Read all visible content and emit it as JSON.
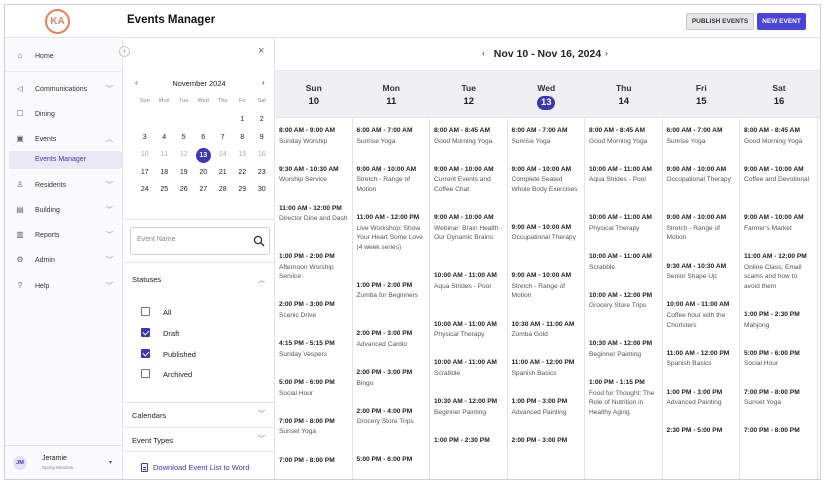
{
  "app": {
    "logo_text": "KA",
    "title": "Events Manager",
    "publish_label": "PUBLISH EVENTS",
    "new_event_label": "NEW EVENT"
  },
  "sidebar": {
    "items": [
      {
        "key": "home",
        "label": "Home",
        "icon": "home-icon",
        "chevron": false
      },
      {
        "key": "communications",
        "label": "Communications",
        "icon": "megaphone-icon",
        "chevron": true
      },
      {
        "key": "dining",
        "label": "Dining",
        "icon": "dining-icon",
        "chevron": false
      },
      {
        "key": "events",
        "label": "Events",
        "icon": "calendar-icon",
        "chevron": true,
        "expanded": true
      },
      {
        "key": "residents",
        "label": "Residents",
        "icon": "person-icon",
        "chevron": true
      },
      {
        "key": "building",
        "label": "Building",
        "icon": "building-icon",
        "chevron": true
      },
      {
        "key": "reports",
        "label": "Reports",
        "icon": "bar-chart-icon",
        "chevron": true
      },
      {
        "key": "admin",
        "label": "Admin",
        "icon": "gear-icon",
        "chevron": true
      },
      {
        "key": "help",
        "label": "Help",
        "icon": "help-icon",
        "chevron": true
      }
    ],
    "active_sub": "Events Manager"
  },
  "user": {
    "initials": "JM",
    "name": "Jeramie",
    "location": "Spring Meadow"
  },
  "mini_calendar": {
    "month_label": "November 2024",
    "weekdays": [
      "Sun",
      "Mon",
      "Tue",
      "Wed",
      "Thu",
      "Fri",
      "Sat"
    ],
    "weeks": [
      [
        "",
        "",
        "",
        "",
        "",
        "1",
        "2"
      ],
      [
        "3",
        "4",
        "5",
        "6",
        "7",
        "8",
        "9"
      ],
      [
        "10",
        "11",
        "12",
        "13",
        "14",
        "15",
        "16"
      ],
      [
        "17",
        "18",
        "19",
        "20",
        "21",
        "22",
        "23"
      ],
      [
        "24",
        "25",
        "26",
        "27",
        "28",
        "29",
        "30"
      ]
    ],
    "today": "13",
    "muted_days": [
      "10",
      "11",
      "12",
      "14",
      "15",
      "16"
    ]
  },
  "filters": {
    "search_placeholder": "Event Name",
    "statuses_label": "Statuses",
    "statuses": [
      {
        "label": "All",
        "checked": false
      },
      {
        "label": "Draft",
        "checked": true
      },
      {
        "label": "Published",
        "checked": true
      },
      {
        "label": "Archived",
        "checked": false
      }
    ],
    "calendars_label": "Calendars",
    "event_types_label": "Event Types",
    "download_label": "Download Event List to Word"
  },
  "week": {
    "range_label": "Nov 10 - Nov 16, 2024",
    "current_day": "13",
    "days": [
      {
        "name": "Sun",
        "num": "10",
        "events": [
          {
            "time": "8:00 AM - 9:00 AM",
            "title": "Sunday Worship"
          },
          {
            "time": "9:30 AM - 10:30 AM",
            "title": "Worship Service"
          },
          {
            "time": "11:00 AM - 12:00 PM",
            "title": "Director Dine and Dash"
          },
          {
            "time": "1:00 PM - 2:00 PM",
            "title": "Afternoon Worship Service"
          },
          {
            "time": "2:00 PM - 3:00 PM",
            "title": "Scenic Drive"
          },
          {
            "time": "4:15 PM - 5:15 PM",
            "title": "Sunday Vespers"
          },
          {
            "time": "5:00 PM - 6:00 PM",
            "title": "Social Hour"
          },
          {
            "time": "7:00 PM - 8:00 PM",
            "title": "Sunset Yoga"
          },
          {
            "time": "7:00 PM - 8:00 PM",
            "title": ""
          }
        ]
      },
      {
        "name": "Mon",
        "num": "11",
        "events": [
          {
            "time": "6:00 AM - 7:00 AM",
            "title": "Sunrise Yoga"
          },
          {
            "time": "9:00 AM - 10:00 AM",
            "title": "Stretch - Range of Motion"
          },
          {
            "time": "11:00 AM - 12:00 PM",
            "title": "Live Workshop: Show Your Heart Some Love (4 week series)"
          },
          {
            "time": "1:00 PM - 2:00 PM",
            "title": "Zumba for Beginners"
          },
          {
            "time": "2:00 PM - 3:00 PM",
            "title": "Advanced Cardio"
          },
          {
            "time": "2:00 PM - 3:00 PM",
            "title": "Bingo"
          },
          {
            "time": "2:00 PM - 4:00 PM",
            "title": "Grocery Store Trips"
          },
          {
            "time": "5:00 PM - 6:00 PM",
            "title": ""
          }
        ]
      },
      {
        "name": "Tue",
        "num": "12",
        "events": [
          {
            "time": "8:00 AM - 8:45 AM",
            "title": "Good Morning Yoga"
          },
          {
            "time": "9:00 AM - 10:00 AM",
            "title": "Current Events and Coffee Chat"
          },
          {
            "time": "9:00 AM - 10:00 AM",
            "title": "Webinar: Brain Health - Our Dynamic Brains"
          },
          {
            "time": "10:00 AM - 11:00 AM",
            "title": "Aqua Strides - Pool"
          },
          {
            "time": "10:00 AM - 11:00 AM",
            "title": "Physical Therapy"
          },
          {
            "time": "10:00 AM - 11:00 AM",
            "title": "Scrabble"
          },
          {
            "time": "10:30 AM - 12:00 PM",
            "title": "Beginner Painting"
          },
          {
            "time": "1:00 PM - 2:30 PM",
            "title": ""
          }
        ]
      },
      {
        "name": "Wed",
        "num": "13",
        "events": [
          {
            "time": "6:00 AM - 7:00 AM",
            "title": "Sunrise Yoga"
          },
          {
            "time": "9:00 AM - 10:00 AM",
            "title": "Complete Seated Whole Body Exercises"
          },
          {
            "time": "9:00 AM - 10:00 AM",
            "title": "Occupational Therapy"
          },
          {
            "time": "9:00 AM - 10:00 AM",
            "title": "Stretch - Range of Motion"
          },
          {
            "time": "10:30 AM - 11:00 AM",
            "title": "Zumba Gold"
          },
          {
            "time": "11:00 AM - 12:00 PM",
            "title": "Spanish Basics"
          },
          {
            "time": "1:00 PM - 3:00 PM",
            "title": "Advanced Painting"
          },
          {
            "time": "2:00 PM - 3:00 PM",
            "title": ""
          }
        ]
      },
      {
        "name": "Thu",
        "num": "14",
        "events": [
          {
            "time": "8:00 AM - 8:45 AM",
            "title": "Good Morning Yoga"
          },
          {
            "time": "10:00 AM - 11:00 AM",
            "title": "Aqua Strides - Pool"
          },
          {
            "time": "10:00 AM - 11:00 AM",
            "title": "Physical Therapy"
          },
          {
            "time": "10:00 AM - 11:00 AM",
            "title": "Scrabble"
          },
          {
            "time": "10:00 AM - 12:00 PM",
            "title": "Grocery Store Trips"
          },
          {
            "time": "10:30 AM - 12:00 PM",
            "title": "Beginner Painting"
          },
          {
            "time": "1:00 PM - 1:15 PM",
            "title": "Food for Thought: The Role of Nutrition in Healthy Aging"
          }
        ]
      },
      {
        "name": "Fri",
        "num": "15",
        "events": [
          {
            "time": "6:00 AM - 7:00 AM",
            "title": "Sunrise Yoga"
          },
          {
            "time": "9:00 AM - 10:00 AM",
            "title": "Occupational Therapy"
          },
          {
            "time": "9:00 AM - 10:00 AM",
            "title": "Stretch - Range of Motion"
          },
          {
            "time": "9:30 AM - 10:30 AM",
            "title": "Senior Shape Up"
          },
          {
            "time": "10:00 AM - 11:00 AM",
            "title": "Coffee hour with the Choristers"
          },
          {
            "time": "11:00 AM - 12:00 PM",
            "title": "Spanish Basics"
          },
          {
            "time": "1:00 PM - 3:00 PM",
            "title": "Advanced Painting"
          },
          {
            "time": "2:30 PM - 5:00 PM",
            "title": ""
          }
        ]
      },
      {
        "name": "Sat",
        "num": "16",
        "events": [
          {
            "time": "8:00 AM - 8:45 AM",
            "title": "Good Morning Yoga"
          },
          {
            "time": "9:00 AM - 10:00 AM",
            "title": "Coffee and Devotional"
          },
          {
            "time": "9:00 AM - 10:00 AM",
            "title": "Farmer's Market"
          },
          {
            "time": "11:00 AM - 12:00 PM",
            "title": "Online Class: Email scams and how to avoid them"
          },
          {
            "time": "1:00 PM - 2:30 PM",
            "title": "Mahjong"
          },
          {
            "time": "5:00 PM - 6:00 PM",
            "title": "Social Hour"
          },
          {
            "time": "7:00 PM - 8:00 PM",
            "title": "Sunset Yoga"
          },
          {
            "time": "7:00 PM - 8:00 PM",
            "title": ""
          }
        ]
      }
    ]
  },
  "colors": {
    "accent": "#4a45d8",
    "accent_dark": "#3b37b8",
    "logo": "#e9825a"
  }
}
